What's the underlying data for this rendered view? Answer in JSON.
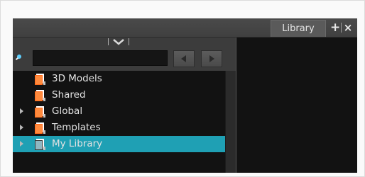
{
  "window": {
    "tab_title": "Library",
    "add_tab_symbol": "+",
    "close_tab_symbol": "×"
  },
  "search": {
    "value": "",
    "placeholder": ""
  },
  "tree": {
    "items": [
      {
        "label": "3D Models",
        "expandable": false,
        "selected": false
      },
      {
        "label": "Shared",
        "expandable": false,
        "selected": false
      },
      {
        "label": "Global",
        "expandable": true,
        "selected": false
      },
      {
        "label": "Templates",
        "expandable": true,
        "selected": false
      },
      {
        "label": "My Library",
        "expandable": true,
        "selected": true
      }
    ]
  },
  "colors": {
    "selection": "#1fa0b4",
    "panel_bg": "#3c3c3c",
    "list_bg": "#121212",
    "folder_orange": "#ff6a1a"
  },
  "icons": {
    "search": "magnifier-icon",
    "collapse": "chevron-down-icon",
    "back": "triangle-left-icon",
    "forward": "triangle-right-icon",
    "folder": "library-folder-icon",
    "expand": "expand-arrow-icon"
  }
}
